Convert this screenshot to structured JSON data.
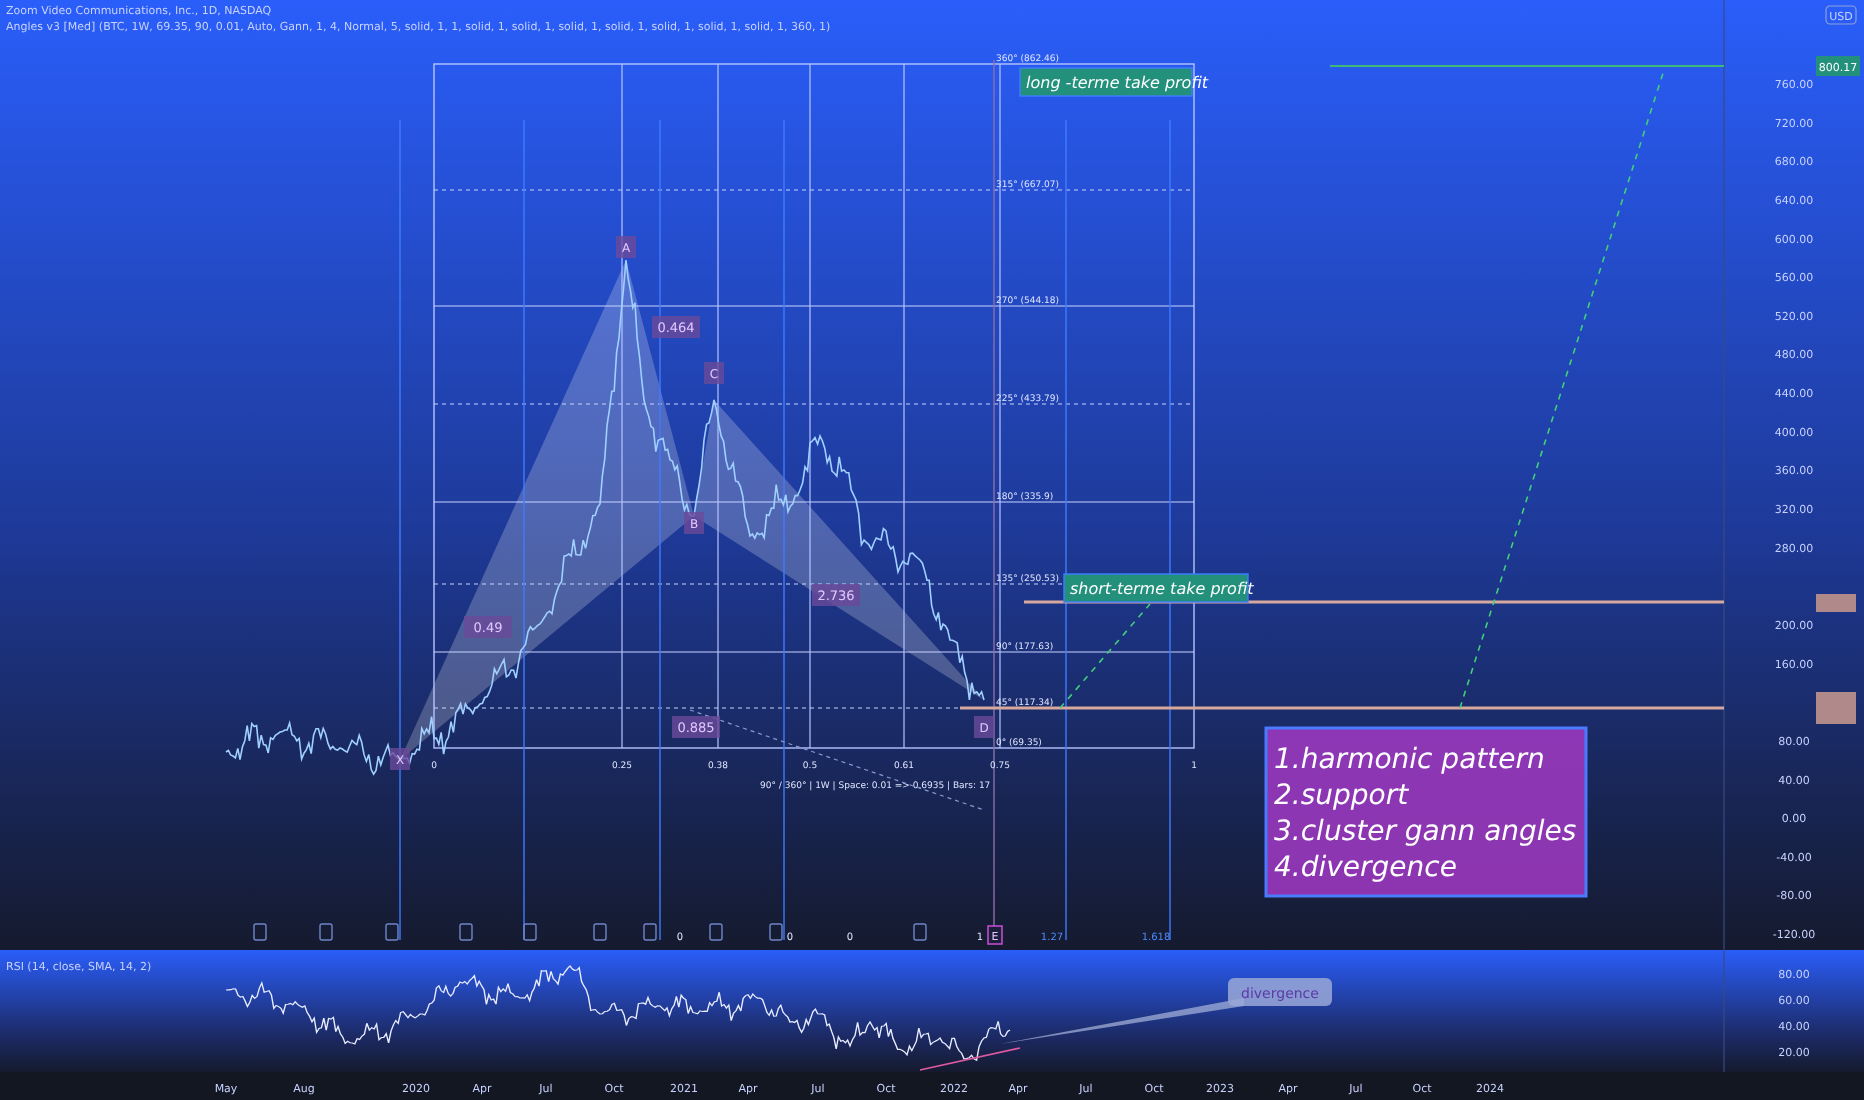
{
  "header": {
    "symbol": "Zoom Video Communications, Inc., 1D, NASDAQ",
    "indicator": "Angles v3 [Med] (BTC, 1W, 69.35, 90, 0.01, Auto, Gann, 1, 4, Normal, 5, solid, 1, 1, solid, 1, solid, 1, solid, 1, solid, 1, solid, 1, solid, 1, solid, 1, 360, 1)"
  },
  "price_axis": {
    "currency": "USD",
    "labels": [
      "760.00",
      "720.00",
      "680.00",
      "640.00",
      "600.00",
      "560.00",
      "520.00",
      "480.00",
      "440.00",
      "400.00",
      "360.00",
      "320.00",
      "280.00",
      "200.00",
      "160.00",
      "80.00",
      "40.00",
      "0.00",
      "-40.00",
      "-80.00",
      "-120.00"
    ],
    "last_price": "800.17"
  },
  "gann_box": {
    "angles": [
      "360° (862.46)",
      "315° (667.07)",
      "270° (544.18)",
      "225° (433.79)",
      "180° (335.9)",
      "135° (250.53)",
      "90° (177.63)",
      "45° (117.34)",
      "0° (69.35)"
    ],
    "ratios": [
      "0",
      "0.25",
      "0.38",
      "0.5",
      "0.61",
      "0.75",
      "1"
    ],
    "info": "90° / 360° | 1W | Space: 0.01 => 0.6935 | Bars: 17"
  },
  "pattern": {
    "points": [
      "X",
      "A",
      "B",
      "C",
      "D"
    ],
    "ratios": [
      "0.464",
      "0.49",
      "2.736",
      "0.885"
    ]
  },
  "targets": [
    {
      "label": "long -terme take profit"
    },
    {
      "label": "short-terme take profit"
    }
  ],
  "notes": [
    "1.harmonic pattern",
    "2.support",
    "3.cluster gann angles",
    "4.divergence"
  ],
  "time_fib": {
    "labels": [
      "0",
      "0",
      "0",
      "1",
      "1.27",
      "1.618"
    ],
    "end_mark": "E"
  },
  "rsi": {
    "title": "RSI (14, close, SMA, 14, 2)",
    "axis": [
      "80.00",
      "60.00",
      "40.00",
      "20.00"
    ],
    "callout": "divergence"
  },
  "time_axis": [
    "May",
    "Aug",
    "2020",
    "Apr",
    "Jul",
    "Oct",
    "2021",
    "Apr",
    "Jul",
    "Oct",
    "2022",
    "Apr",
    "Jul",
    "Oct",
    "2023",
    "Apr",
    "Jul",
    "Oct",
    "2024"
  ]
}
